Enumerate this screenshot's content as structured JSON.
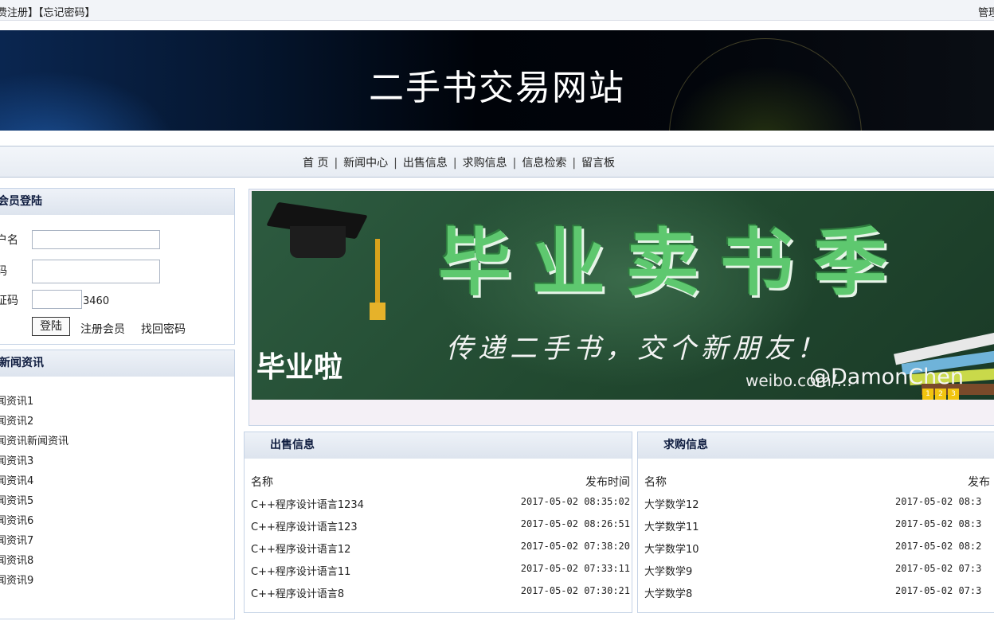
{
  "topbar": {
    "left_text": "费注册】【忘记密码】",
    "right_text": "管理"
  },
  "banner": {
    "title": "二手书交易网站"
  },
  "nav": {
    "items": [
      "首 页",
      "新闻中心",
      "出售信息",
      "求购信息",
      "信息检索",
      "留言板"
    ]
  },
  "login": {
    "title": "会员登陆",
    "username_label": "户名",
    "password_label": "码",
    "captcha_label": "证码",
    "captcha_value": "3460",
    "login_button": "登陆",
    "register_link": "注册会员",
    "recover_link": "找回密码"
  },
  "news": {
    "title": "新闻资讯",
    "items": [
      "闻资讯1",
      "闻资讯2",
      "闻资讯新闻资讯",
      "闻资讯3",
      "闻资讯4",
      "闻资讯5",
      "闻资讯6",
      "闻资讯7",
      "闻资讯8",
      "闻资讯9"
    ]
  },
  "ad": {
    "headline": "毕业卖书季",
    "slogan": "传递二手书，交个新朋友！",
    "left_text": "毕业啦",
    "watermark": "@DamonChen",
    "weibo_text": "weibo.com/...",
    "pager": [
      "1",
      "2",
      "3"
    ],
    "colors": {
      "board": "#2d5b40",
      "headline": "#5ec86f",
      "pager": "#f1c40f"
    }
  },
  "sell": {
    "title": "出售信息",
    "col_name": "名称",
    "col_date": "发布时间",
    "rows": [
      {
        "name": "C++程序设计语言1234",
        "date": "2017-05-02 08:35:02"
      },
      {
        "name": "C++程序设计语言123",
        "date": "2017-05-02 08:26:51"
      },
      {
        "name": "C++程序设计语言12",
        "date": "2017-05-02 07:38:20"
      },
      {
        "name": "C++程序设计语言11",
        "date": "2017-05-02 07:33:11"
      },
      {
        "name": "C++程序设计语言8",
        "date": "2017-05-02 07:30:21"
      }
    ]
  },
  "buy": {
    "title": "求购信息",
    "col_name": "名称",
    "col_date": "发布",
    "rows": [
      {
        "name": "大学数学12",
        "date": "2017-05-02 08:3"
      },
      {
        "name": "大学数学11",
        "date": "2017-05-02 08:3"
      },
      {
        "name": "大学数学10",
        "date": "2017-05-02 08:2"
      },
      {
        "name": "大学数学9",
        "date": "2017-05-02 07:3"
      },
      {
        "name": "大学数学8",
        "date": "2017-05-02 07:3"
      }
    ]
  }
}
